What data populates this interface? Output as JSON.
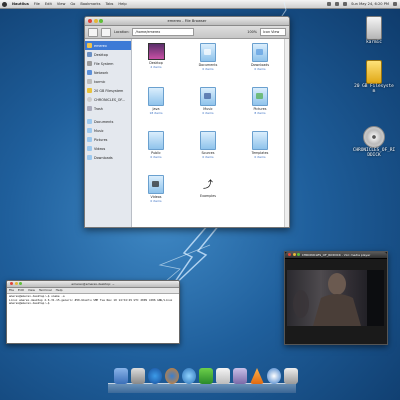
{
  "panel": {
    "app_name": "Nautilus",
    "menus": [
      "File",
      "Edit",
      "View",
      "Go",
      "Bookmarks",
      "Tabs",
      "Help"
    ],
    "clock": "Sun May 24, 6:20 PM"
  },
  "file_browser": {
    "title": "emerex - File Browser",
    "location_label": "Location:",
    "location_value": "/home/emerex",
    "zoom": "100%",
    "view_mode": "Icon View",
    "sidebar": [
      {
        "label": "emerex",
        "icon": "home-icon",
        "selected": true
      },
      {
        "label": "Desktop",
        "icon": "desktop-icon"
      },
      {
        "label": "File System",
        "icon": "harddisk-icon"
      },
      {
        "label": "Network",
        "icon": "network-icon"
      },
      {
        "label": "karmic",
        "icon": "drive-icon"
      },
      {
        "label": "20 GB Filesystem",
        "icon": "drive-icon"
      },
      {
        "label": "CHRONICLES_OF...",
        "icon": "cd-icon"
      },
      {
        "label": "Trash",
        "icon": "trash-icon"
      },
      {
        "label": "Documents",
        "icon": "folder-icon"
      },
      {
        "label": "Music",
        "icon": "folder-icon"
      },
      {
        "label": "Pictures",
        "icon": "folder-icon"
      },
      {
        "label": "Videos",
        "icon": "folder-icon"
      },
      {
        "label": "Downloads",
        "icon": "folder-icon"
      }
    ],
    "items": [
      {
        "name": "Desktop",
        "count": "2 items",
        "icon": "desktop-folder-icon"
      },
      {
        "name": "Documents",
        "count": "0 items",
        "icon": "documents-folder-icon"
      },
      {
        "name": "Downloads",
        "count": "0 items",
        "icon": "downloads-folder-icon"
      },
      {
        "name": "Java",
        "count": "18 items",
        "icon": "folder-icon"
      },
      {
        "name": "Music",
        "count": "0 items",
        "icon": "music-folder-icon"
      },
      {
        "name": "Pictures",
        "count": "8 items",
        "icon": "pictures-folder-icon"
      },
      {
        "name": "Public",
        "count": "0 items",
        "icon": "public-folder-icon"
      },
      {
        "name": "Sources",
        "count": "0 items",
        "icon": "folder-icon"
      },
      {
        "name": "Templates",
        "count": "0 items",
        "icon": "templates-folder-icon"
      },
      {
        "name": "Videos",
        "count": "0 items",
        "icon": "videos-folder-icon"
      },
      {
        "name": "Examples",
        "count": "",
        "icon": "examples-link-icon"
      }
    ]
  },
  "desktop_icons": [
    {
      "label": "karmic",
      "icon": "harddisk-icon"
    },
    {
      "label": "20 GB Filesystem",
      "icon": "usb-drive-icon"
    },
    {
      "label": "CHRONICLES_OF_RIDDICK",
      "icon": "cd-icon"
    }
  ],
  "terminal": {
    "title": "emerex@emerex-desktop: ~",
    "menus": [
      "File",
      "Edit",
      "View",
      "Terminal",
      "Help"
    ],
    "lines": [
      "emerex@emerex-desktop:~$ uname -a",
      "Linux emerex-desktop 2.6.31-15-generic #50-Ubuntu SMP Tue Nov 10 14:54:29 UTC 2009 i686 GNU/Linux",
      "emerex@emerex-desktop:~$ "
    ]
  },
  "video_player": {
    "title": "CHRONICLES_OF_RIDDICK - VLC media player"
  },
  "dock": {
    "items": [
      "finder-icon",
      "photos-icon",
      "ie-icon",
      "firefox-icon",
      "music-icon",
      "vuze-icon",
      "mail-icon",
      "pidgin-icon",
      "vlc-icon",
      "kde-icon",
      "trash-icon"
    ]
  }
}
